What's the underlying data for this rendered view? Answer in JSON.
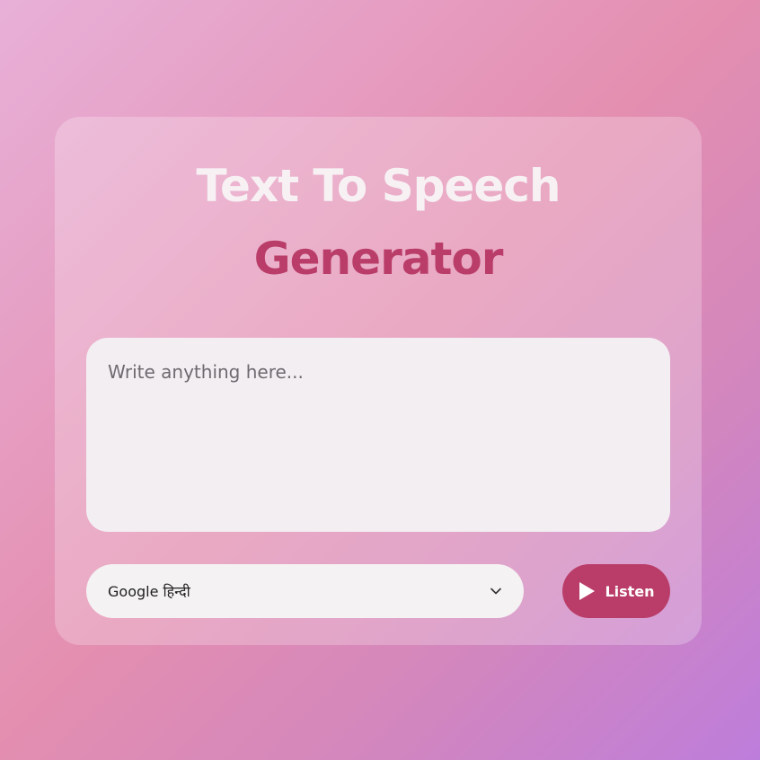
{
  "header": {
    "title_line1": "Text To Speech",
    "title_line2": "Generator"
  },
  "text_input": {
    "placeholder": "Write anything here...",
    "value": ""
  },
  "voice_select": {
    "selected": "Google हिन्दी",
    "icon": "chevron-down-icon"
  },
  "listen_button": {
    "label": "Listen",
    "icon": "play-icon"
  },
  "colors": {
    "accent": "#b93d68",
    "title_light": "#f7f1f4",
    "input_bg": "#f3eef2"
  }
}
